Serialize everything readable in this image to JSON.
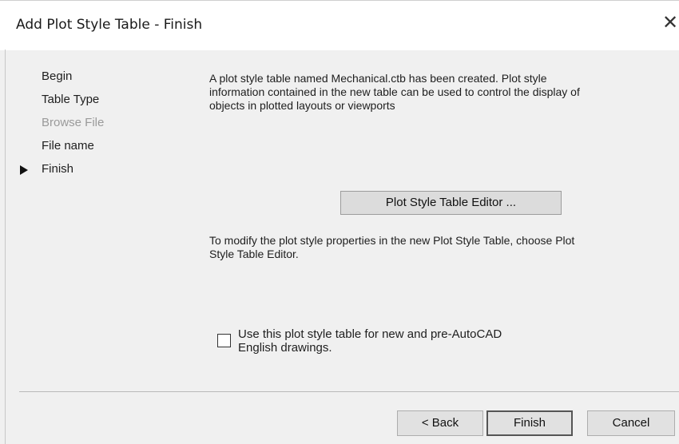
{
  "window": {
    "title": "Add Plot Style Table - Finish",
    "close_glyph": "✕",
    "close_icon": "close-icon"
  },
  "nav": {
    "items": [
      {
        "label": "Begin",
        "state": "normal"
      },
      {
        "label": "Table Type",
        "state": "normal"
      },
      {
        "label": "Browse File",
        "state": "disabled"
      },
      {
        "label": "File name",
        "state": "normal"
      },
      {
        "label": "Finish",
        "state": "current"
      }
    ],
    "current_icon": "triangle-right-icon"
  },
  "content": {
    "description": "A plot style table named Mechanical.ctb has been created. Plot style information contained in the new table can be used to control the display of objects in plotted layouts or viewports",
    "editor_button_label": "Plot Style Table Editor ...",
    "modify_text": "To modify the plot style properties in the new Plot Style Table, choose Plot Style Table Editor.",
    "checkbox_label": "Use this plot style table for new and pre-AutoCAD English drawings.",
    "checkbox_checked": false
  },
  "footer": {
    "back_label": "< Back",
    "finish_label": "Finish",
    "cancel_label": "Cancel"
  }
}
